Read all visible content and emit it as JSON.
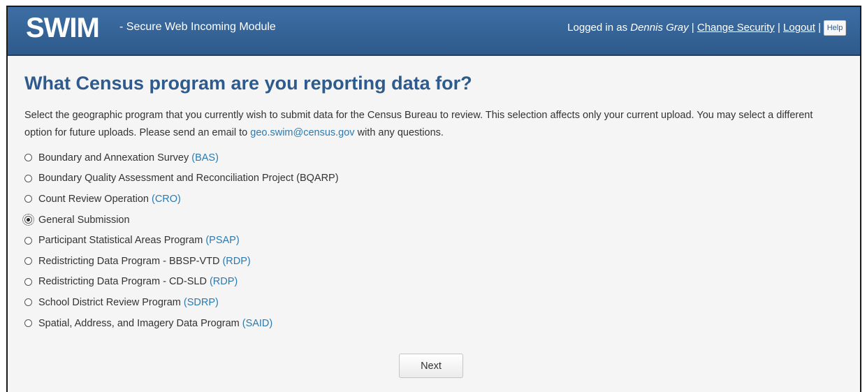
{
  "header": {
    "logo": "SWIM",
    "tagline": "- Secure Web Incoming Module",
    "logged_in_prefix": "Logged in as",
    "user_name": "Dennis Gray",
    "separator": "|",
    "change_security": "Change Security",
    "logout": "Logout",
    "help": "Help"
  },
  "main": {
    "title": "What Census program are you reporting data for?",
    "intro_text": "Select the geographic program that you currently wish to submit data for the Census Bureau to review. This selection affects only your current upload. You may select a different option for future uploads. Please send an email to",
    "email": "geo.swim@census.gov",
    "intro_suffix": "with any questions.",
    "options": [
      {
        "label": "Boundary and Annexation Survey",
        "abbr": "(BAS)",
        "selected": false
      },
      {
        "label": "Boundary Quality Assessment and Reconciliation Project (BQARP)",
        "abbr": "",
        "selected": false
      },
      {
        "label": "Count Review Operation",
        "abbr": "(CRO)",
        "selected": false
      },
      {
        "label": "General Submission",
        "abbr": "",
        "selected": true
      },
      {
        "label": "Participant Statistical Areas Program",
        "abbr": "(PSAP)",
        "selected": false
      },
      {
        "label": "Redistricting Data Program - BBSP-VTD",
        "abbr": "(RDP)",
        "selected": false
      },
      {
        "label": "Redistricting Data Program - CD-SLD",
        "abbr": "(RDP)",
        "selected": false
      },
      {
        "label": "School District Review Program",
        "abbr": "(SDRP)",
        "selected": false
      },
      {
        "label": "Spatial, Address, and Imagery Data Program",
        "abbr": "(SAID)",
        "selected": false
      }
    ],
    "next_label": "Next"
  }
}
